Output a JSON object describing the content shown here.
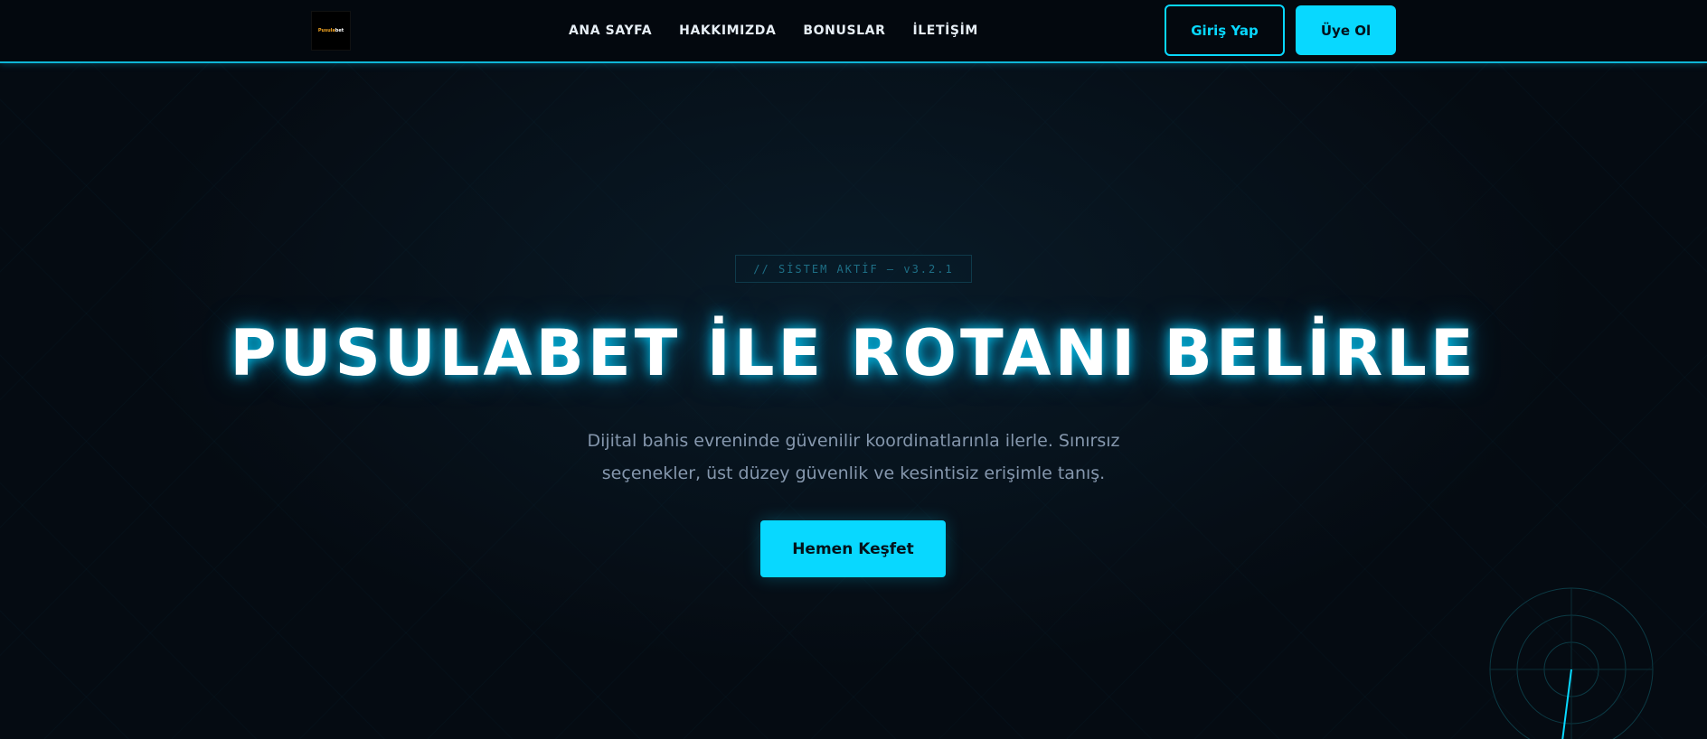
{
  "header": {
    "logo": {
      "text_orange": "Pusula",
      "text_white": "bet"
    },
    "nav": [
      {
        "label": "ANA SAYFA"
      },
      {
        "label": "HAKKIMIZDA"
      },
      {
        "label": "BONUSLAR"
      },
      {
        "label": "İLETİŞİM"
      }
    ],
    "login_label": "Giriş Yap",
    "register_label": "Üye Ol"
  },
  "hero": {
    "badge": "// SİSTEM AKTİF — v3.2.1",
    "title": "PUSULABET İLE ROTANI BELİRLE",
    "subtitle": "Dijital bahis evreninde güvenilir koordinatlarınla ilerle. Sınırsız seçenekler, üst düzey güvenlik ve kesintisiz erişimle tanış.",
    "cta_label": "Hemen Keşfet"
  },
  "colors": {
    "accent": "#08d8ff",
    "background": "#050b12",
    "logo_orange": "#f5a623"
  },
  "icons": {
    "radar": "radar-icon"
  }
}
